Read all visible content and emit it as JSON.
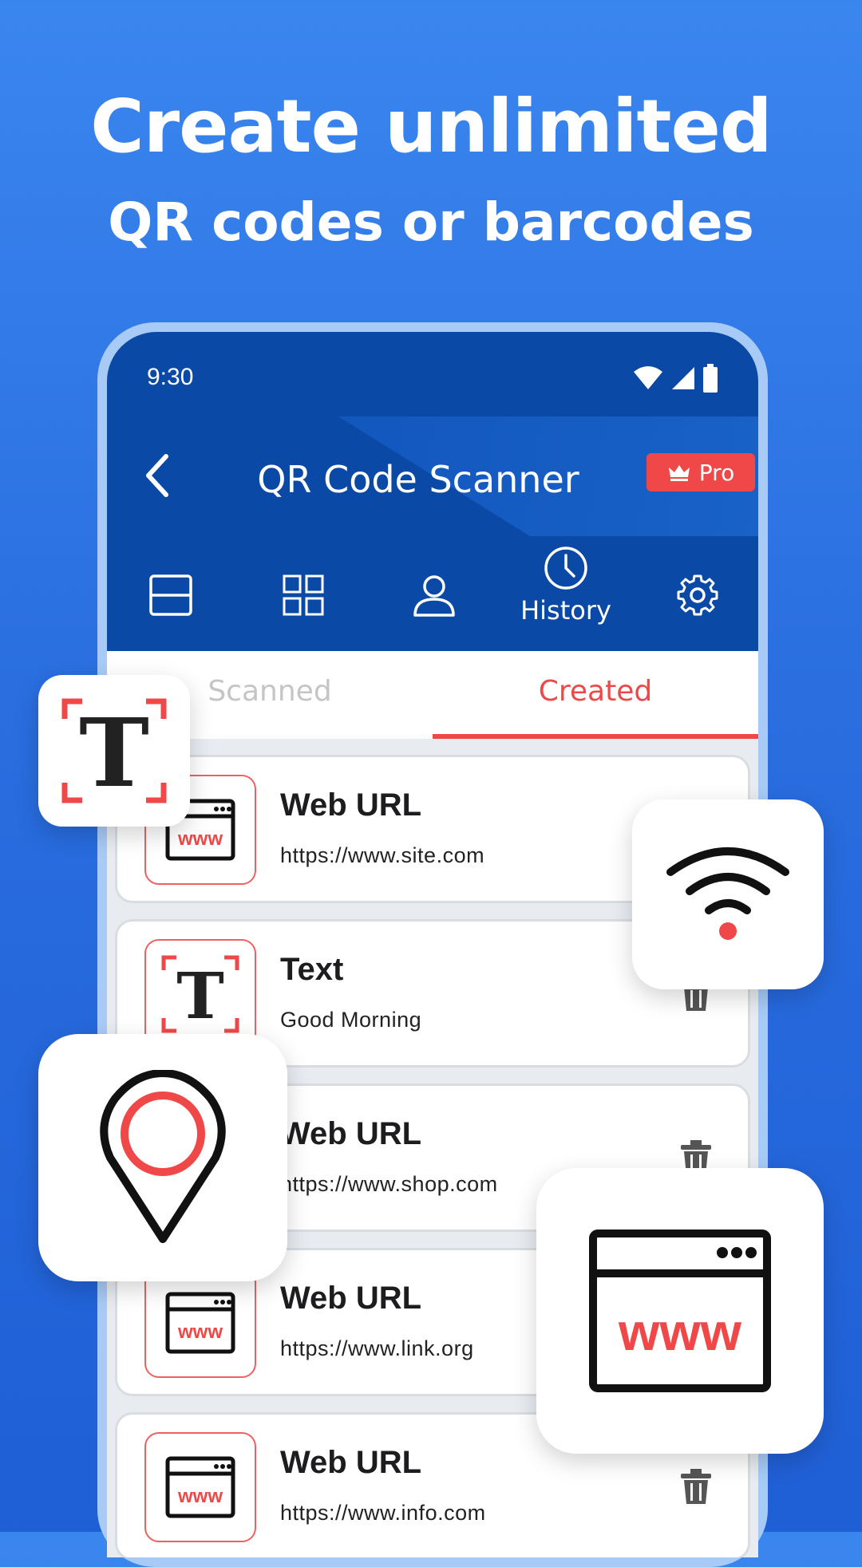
{
  "headline": {
    "line1": "Create unlimited",
    "line2": "QR codes or barcodes"
  },
  "status": {
    "time": "9:30"
  },
  "appbar": {
    "title": "QR Code Scanner",
    "pro_label": "Pro"
  },
  "nav": {
    "items": [
      {
        "icon": "scan-icon",
        "label": ""
      },
      {
        "icon": "grid-icon",
        "label": ""
      },
      {
        "icon": "person-icon",
        "label": ""
      },
      {
        "icon": "clock-icon",
        "label": "History"
      },
      {
        "icon": "gear-icon",
        "label": ""
      }
    ]
  },
  "tabs": {
    "scanned": "Scanned",
    "created": "Created"
  },
  "items": [
    {
      "type": "Web URL",
      "value": "https://www.site.com",
      "icon": "www-icon"
    },
    {
      "type": "Text",
      "value": "Good Morning",
      "icon": "text-icon"
    },
    {
      "type": "Web URL",
      "value": "https://www.shop.com",
      "icon": "www-icon"
    },
    {
      "type": "Web URL",
      "value": "https://www.link.org",
      "icon": "www-icon"
    },
    {
      "type": "Web URL",
      "value": "https://www.info.com",
      "icon": "www-icon"
    }
  ],
  "colors": {
    "primary": "#0a4aa6",
    "accent": "#f04848",
    "background": "#2a6ee0"
  }
}
